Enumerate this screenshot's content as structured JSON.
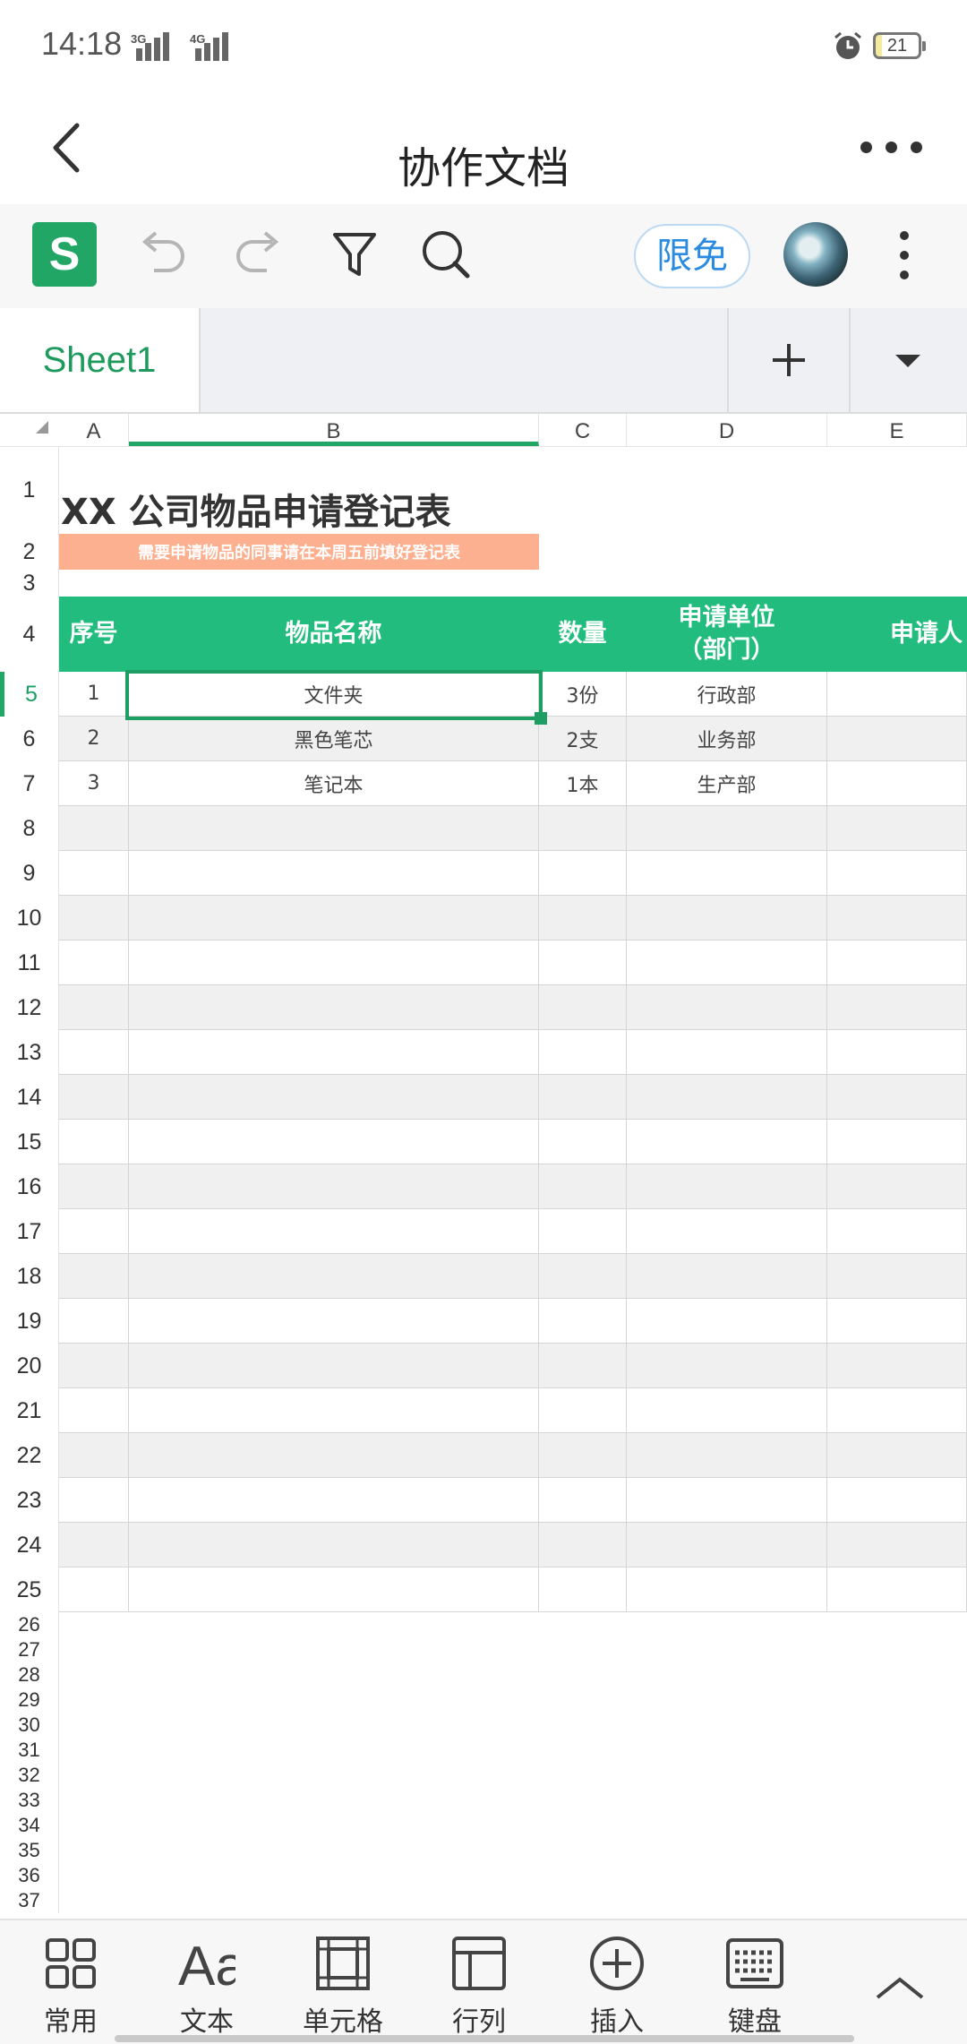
{
  "status_bar": {
    "time": "14:18",
    "net1": "3G",
    "net2": "4G",
    "battery": "21"
  },
  "title_bar": {
    "title": "协作文档"
  },
  "toolbar": {
    "app_logo": "S",
    "limited_free": "限免"
  },
  "sheet_tabs": {
    "active": "Sheet1"
  },
  "columns": [
    "A",
    "B",
    "C",
    "D",
    "E"
  ],
  "rows": [
    "1",
    "2",
    "3",
    "4",
    "5",
    "6",
    "7",
    "8",
    "9",
    "10",
    "11",
    "12",
    "13",
    "14",
    "15",
    "16",
    "17",
    "18",
    "19",
    "20",
    "21",
    "22",
    "23",
    "24",
    "25",
    "26",
    "27",
    "28",
    "29",
    "30",
    "31",
    "32",
    "33",
    "34",
    "35",
    "36",
    "37"
  ],
  "sheet": {
    "title": "XX 公司物品申请登记表",
    "note": "需要申请物品的同事请在本周五前填好登记表",
    "headers": [
      "序号",
      "物品名称",
      "数量",
      "申请单位\n（部门）",
      "申请人"
    ],
    "records": [
      [
        "1",
        "文件夹",
        "3份",
        "行政部",
        ""
      ],
      [
        "2",
        "黑色笔芯",
        "2支",
        "业务部",
        ""
      ],
      [
        "3",
        "笔记本",
        "1本",
        "生产部",
        ""
      ]
    ],
    "selected_cell": "B5"
  },
  "bottom_toolbar": {
    "items": [
      {
        "label": "常用",
        "icon": "grid-icon"
      },
      {
        "label": "文本",
        "icon": "text-aa-icon"
      },
      {
        "label": "单元格",
        "icon": "cell-icon"
      },
      {
        "label": "行列",
        "icon": "row-column-icon"
      },
      {
        "label": "插入",
        "icon": "insert-plus-icon"
      },
      {
        "label": "键盘",
        "icon": "keyboard-icon"
      }
    ]
  },
  "colors": {
    "brand_green": "#21a665",
    "header_green": "#22bd7e",
    "note_orange": "#fdb08f",
    "accent_blue": "#2a8be0"
  }
}
